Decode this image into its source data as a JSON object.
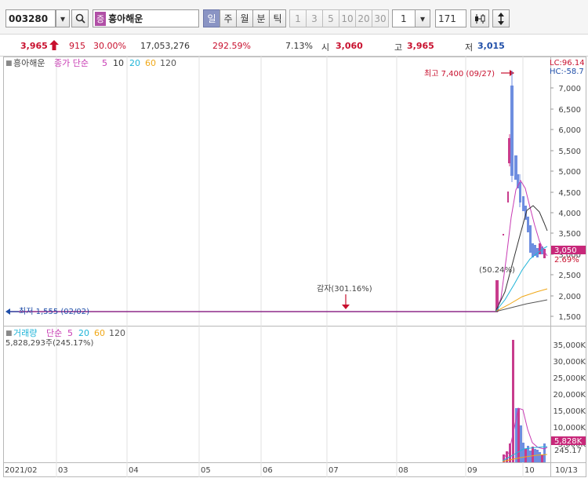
{
  "toolbar": {
    "stock_code": "003280",
    "market_badge": "증",
    "stock_name": "흥아해운",
    "period_tabs": [
      "일",
      "주",
      "월",
      "분",
      "틱"
    ],
    "minute_options": [
      "1",
      "3",
      "5",
      "10",
      "20",
      "30"
    ],
    "multiplier": "1",
    "count": "171"
  },
  "quote": {
    "price": "3,965",
    "change": "915",
    "change_rate": "30.00%",
    "volume": "17,053,276",
    "volume_rate": "292.59%",
    "turnover": "7.13%",
    "open_label": "시",
    "open": "3,060",
    "high_label": "고",
    "high": "3,965",
    "low_label": "저",
    "low": "3,015"
  },
  "price_panel": {
    "name": "흥아해운",
    "ma_label": "종가 단순",
    "ma_periods": [
      "5",
      "10",
      "20",
      "60",
      "120"
    ],
    "lc": "LC:96.14",
    "hc": "HC:-58.7",
    "high_annotation": "최고 7,400 (09/27)",
    "low_annotation": "최저 1,555 (02/02)",
    "event_annotation": "감자(301.16%)",
    "jump_annotation": "(50.24%)",
    "current_price_tag": "3,050",
    "current_rate_tag": "2.69%",
    "y_ticks": [
      "7,000",
      "6,500",
      "6,000",
      "5,500",
      "5,000",
      "4,500",
      "4,000",
      "3,500",
      "3,000",
      "2,500",
      "2,000",
      "1,500"
    ]
  },
  "volume_panel": {
    "name": "거래량",
    "ma_label": "단순",
    "ma_periods": [
      "5",
      "20",
      "60",
      "120"
    ],
    "current_volume": "5,828,293주(245.17%)",
    "current_volume_tag": "5,828K",
    "current_rate_tag": "245.17",
    "y_ticks": [
      "35,000K",
      "30,000K",
      "25,000K",
      "20,000K",
      "15,000K",
      "10,000K",
      "5,000K"
    ]
  },
  "x_axis": {
    "labels": [
      "2021/02",
      "03",
      "04",
      "05",
      "06",
      "07",
      "08",
      "09",
      "10"
    ],
    "right_label": "10/13"
  },
  "colors": {
    "up": "#c8102e",
    "down": "#1f4ea8",
    "ma5": "#c83cb4",
    "ma10": "#333333",
    "ma20": "#1fb4d8",
    "ma60": "#f0a818",
    "ma120": "#555555",
    "candle_up": "#c83c8c",
    "candle_down": "#6e8ee0"
  }
}
